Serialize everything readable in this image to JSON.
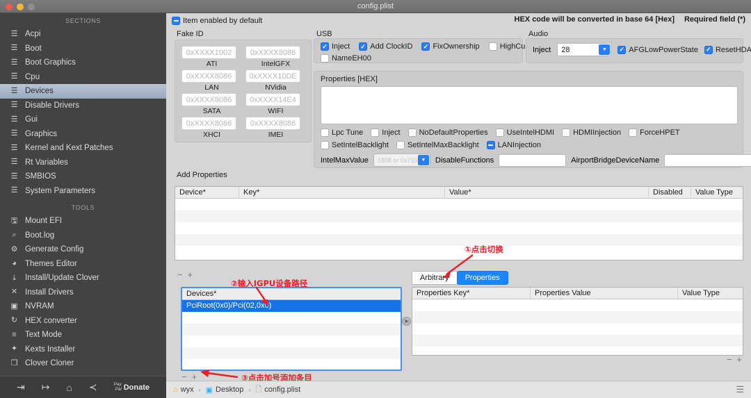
{
  "window": {
    "title": "config.plist"
  },
  "sidebar": {
    "sections_header": "SECTIONS",
    "sections": [
      {
        "label": "Acpi",
        "icon": "list-icon"
      },
      {
        "label": "Boot",
        "icon": "list-icon"
      },
      {
        "label": "Boot Graphics",
        "icon": "list-icon"
      },
      {
        "label": "Cpu",
        "icon": "list-icon"
      },
      {
        "label": "Devices",
        "icon": "list-icon",
        "active": true
      },
      {
        "label": "Disable Drivers",
        "icon": "list-icon"
      },
      {
        "label": "Gui",
        "icon": "list-icon"
      },
      {
        "label": "Graphics",
        "icon": "list-icon"
      },
      {
        "label": "Kernel and Kext Patches",
        "icon": "list-icon"
      },
      {
        "label": "Rt Variables",
        "icon": "list-icon"
      },
      {
        "label": "SMBIOS",
        "icon": "list-icon"
      },
      {
        "label": "System Parameters",
        "icon": "list-icon"
      }
    ],
    "tools_header": "TOOLS",
    "tools": [
      {
        "label": "Mount EFI",
        "icon": "disk-icon"
      },
      {
        "label": "Boot.log",
        "icon": "log-search-icon"
      },
      {
        "label": "Generate Config",
        "icon": "gear-icon"
      },
      {
        "label": "Themes Editor",
        "icon": "palette-icon"
      },
      {
        "label": "Install/Update Clover",
        "icon": "download-icon"
      },
      {
        "label": "Install Drivers",
        "icon": "tools-icon"
      },
      {
        "label": "NVRAM",
        "icon": "chip-icon"
      },
      {
        "label": "HEX converter",
        "icon": "refresh-icon"
      },
      {
        "label": "Text Mode",
        "icon": "text-lines-icon"
      },
      {
        "label": "Kexts Installer",
        "icon": "rocket-icon"
      },
      {
        "label": "Clover Cloner",
        "icon": "copy-icon"
      }
    ],
    "footer": {
      "import_icon": "import-icon",
      "export_icon": "export-icon",
      "home_icon": "home-icon",
      "share_icon": "share-icon",
      "paypal_line1": "Pay",
      "paypal_line2": "Pal",
      "donate_label": "Donate"
    }
  },
  "topbar": {
    "item_enabled_label": "Item enabled by default",
    "item_enabled_state": "mixed",
    "hex_note": "HEX code will be converted in base 64 [Hex]",
    "required_note": "Required field (*)"
  },
  "fake_id": {
    "title": "Fake ID",
    "fields": [
      {
        "label": "ATI",
        "placeholder": "0xXXXX1002",
        "value": ""
      },
      {
        "label": "IntelGFX",
        "placeholder": "0xXXXX8086",
        "value": ""
      },
      {
        "label": "LAN",
        "placeholder": "0xXXXX8086",
        "value": ""
      },
      {
        "label": "NVidia",
        "placeholder": "0xXXXX10DE",
        "value": ""
      },
      {
        "label": "SATA",
        "placeholder": "0xXXXX8086",
        "value": ""
      },
      {
        "label": "WIFI",
        "placeholder": "0xXXXX14E4",
        "value": ""
      },
      {
        "label": "XHCI",
        "placeholder": "0xXXXX8086",
        "value": ""
      },
      {
        "label": "IMEI",
        "placeholder": "0xXXXX8086",
        "value": ""
      }
    ]
  },
  "usb": {
    "title": "USB",
    "checks": [
      {
        "label": "Inject",
        "state": "on"
      },
      {
        "label": "Add ClockID",
        "state": "on"
      },
      {
        "label": "FixOwnership",
        "state": "on"
      },
      {
        "label": "HighCurrent",
        "state": "off"
      },
      {
        "label": "NameEH00",
        "state": "off"
      }
    ]
  },
  "audio": {
    "title": "Audio",
    "inject_label": "Inject",
    "inject_value": "28",
    "checks": [
      {
        "label": "AFGLowPowerState",
        "state": "on"
      },
      {
        "label": "ResetHDA",
        "state": "on"
      }
    ]
  },
  "properties_hex": {
    "title": "Properties [HEX]",
    "value": "",
    "checks_row1": [
      {
        "label": "Lpc Tune",
        "state": "off"
      },
      {
        "label": "Inject",
        "state": "off"
      },
      {
        "label": "NoDefaultProperties",
        "state": "off"
      },
      {
        "label": "UseIntelHDMI",
        "state": "off"
      },
      {
        "label": "HDMIInjection",
        "state": "off"
      },
      {
        "label": "ForceHPET",
        "state": "off"
      }
    ],
    "checks_row2": [
      {
        "label": "SetIntelBacklight",
        "state": "off"
      },
      {
        "label": "SetIntelMaxBacklight",
        "state": "off"
      },
      {
        "label": "LANInjection",
        "state": "mixed"
      }
    ],
    "intel_max_value_label": "IntelMaxValue",
    "intel_max_value_placeholder": "1808 or 0x710",
    "intel_max_value": "",
    "disable_functions_label": "DisableFunctions",
    "disable_functions_value": "",
    "airport_label": "AirportBridgeDeviceName",
    "airport_value": ""
  },
  "add_properties": {
    "title": "Add Properties",
    "columns": [
      "Device*",
      "Key*",
      "Value*",
      "Disabled",
      "Value Type"
    ],
    "rows": [],
    "remove_label": "−",
    "add_label": "+"
  },
  "devices_panel": {
    "header": "Devices*",
    "rows": [
      {
        "label": "PciRoot(0x0)/Pci(02,0x0)",
        "selected": true
      },
      {
        "label": "",
        "selected": false
      },
      {
        "label": "",
        "selected": false
      },
      {
        "label": "",
        "selected": false
      },
      {
        "label": "",
        "selected": false
      },
      {
        "label": "",
        "selected": false
      }
    ],
    "remove_label": "−",
    "add_label": "+"
  },
  "prop_tabs": {
    "tabs": [
      {
        "label": "Arbitrary",
        "active": false
      },
      {
        "label": "Properties",
        "active": true
      }
    ],
    "columns": [
      "Properties Key*",
      "Properties Value",
      "Value Type"
    ],
    "rows": [],
    "remove_label": "−",
    "add_label": "+"
  },
  "annotations": [
    {
      "id": "anno-1",
      "text": "①点击切换"
    },
    {
      "id": "anno-2",
      "text": "②输入IGPU设备路径"
    },
    {
      "id": "anno-3",
      "text": "③点击加号添加条目"
    }
  ],
  "statusbar": {
    "crumbs": [
      {
        "label": "wyx",
        "icon": "home-icon"
      },
      {
        "label": "Desktop",
        "icon": "folder-icon"
      },
      {
        "label": "config.plist",
        "icon": "file-icon"
      }
    ],
    "menu_icon": "hamburger-icon"
  },
  "colors": {
    "accent_blue": "#1a86fb",
    "selection_blue": "#1673e6",
    "annotation_red": "#e4202a",
    "sidebar_bg": "#434343"
  }
}
